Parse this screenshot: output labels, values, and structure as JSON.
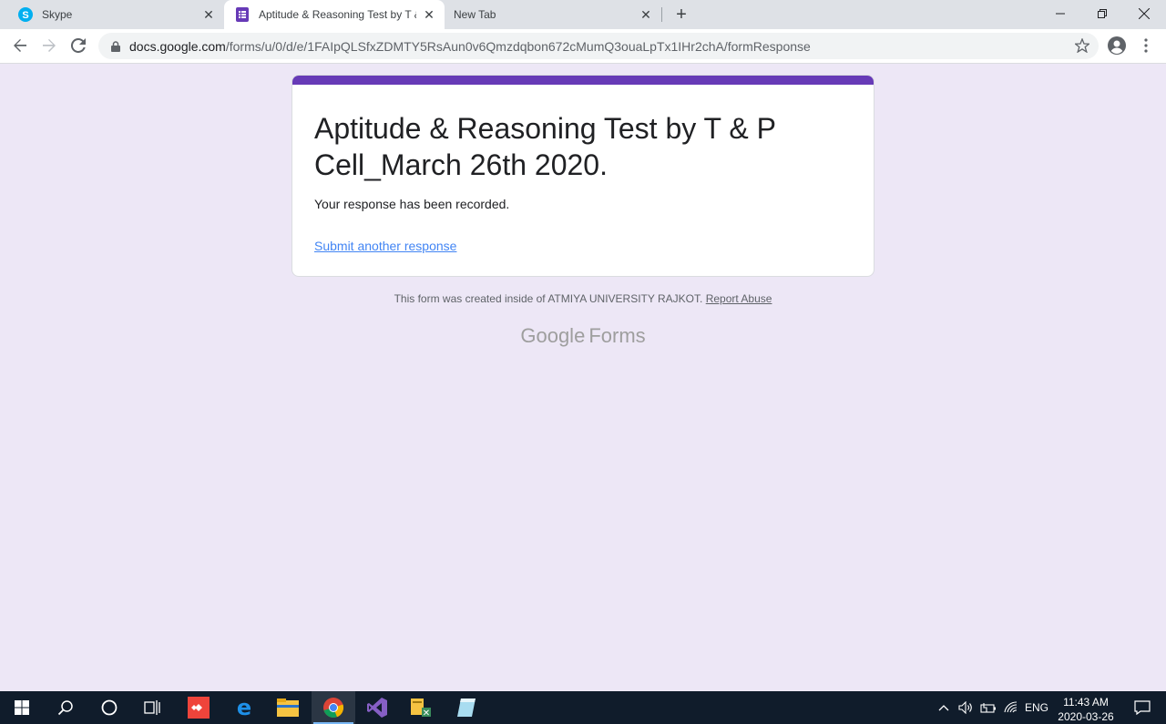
{
  "browser": {
    "tabs": [
      {
        "label": "Skype",
        "icon": "skype-icon"
      },
      {
        "label": "Aptitude & Reasoning Test by T &",
        "icon": "google-forms-icon",
        "active": true
      },
      {
        "label": "New Tab",
        "icon": "none"
      }
    ],
    "new_tab_symbol": "+",
    "close_symbol": "✕",
    "url_host": "docs.google.com",
    "url_path": "/forms/u/0/d/e/1FAIpQLSfxZDMTY5RsAun0v6Qmzdqbon672cMumQ3ouaLpTx1IHr2chA/formResponse"
  },
  "form": {
    "title": "Aptitude & Reasoning Test by T & P Cell_March 26th 2020.",
    "message": "Your response has been recorded.",
    "submit_another": "Submit another response",
    "footer_text": "This form was created inside of ATMIYA UNIVERSITY RAJKOT.",
    "report_abuse": "Report Abuse",
    "logo_google": "Google",
    "logo_forms": "Forms",
    "accent_color": "#673ab7"
  },
  "taskbar": {
    "apps": [
      "start-icon",
      "search-icon",
      "cortana-icon",
      "task-view-icon",
      "anydesk-icon",
      "edge-icon",
      "file-explorer-icon",
      "chrome-icon",
      "visual-studio-icon",
      "xampp-icon",
      "notepad-icon"
    ],
    "language": "ENG",
    "time": "11:43 AM",
    "date": "2020-03-26"
  },
  "colors": {
    "page_bg": "#ede7f6",
    "link": "#4285f4",
    "taskbar_bg": "#101c2b"
  }
}
